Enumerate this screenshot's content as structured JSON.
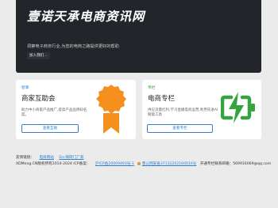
{
  "hero": {
    "title": "壹诺天承电商资讯网",
    "subtitle": "洞察电子商务行业,为您的电商之路提供更好的帮助",
    "join_label": "加入我们..."
  },
  "cards": [
    {
      "tag": "智库",
      "title": "商家互助会",
      "desc": "助力中小商家产品推广,提高产品品牌知名度。",
      "button": "查看互助",
      "icon": "award-ribbon-icon",
      "accent": "#f5901e"
    },
    {
      "tag": "专栏",
      "title": "电商专栏",
      "desc": "供应流量红利,学习直播电商运营,利用先进AI赋能工具",
      "button": "查看专栏",
      "icon": "battery-charging-icon",
      "accent": "#35a33f"
    }
  ],
  "footer": {
    "links_label": "友情链接：",
    "link1": "电商网站",
    "link2": "Els-障碍门厂家",
    "copyright": "XDMeng.CN版权所有2014-2024 ICP备案：",
    "icp": "沪ICP备20009493号-1",
    "police": "鲁公网安备37132202160016号",
    "contact": "开通专栏联系邮箱：569916069@qq.com"
  }
}
